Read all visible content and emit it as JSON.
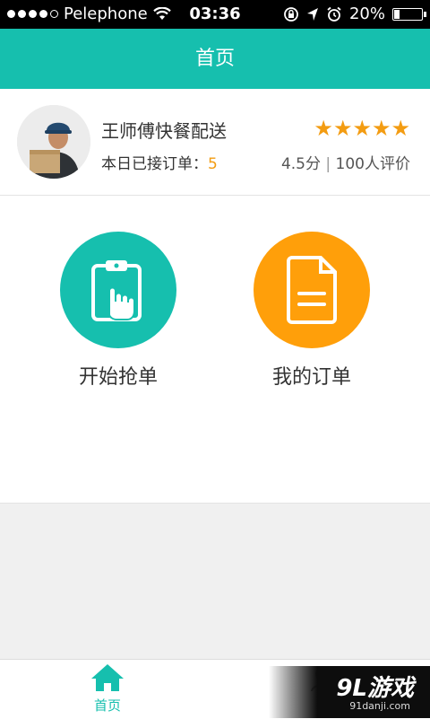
{
  "status_bar": {
    "carrier": "Pelephone",
    "time": "03:36",
    "battery": "20%"
  },
  "nav": {
    "title": "首页"
  },
  "profile": {
    "name": "王师傅快餐配送",
    "orders_label": "本日已接订单：",
    "orders_count": "5",
    "stars": "★★★★★",
    "score": "4.5分",
    "reviews": "100人评价"
  },
  "actions": {
    "grab_label": "开始抢单",
    "orders_label": "我的订单"
  },
  "tabbar": {
    "home_label": "首页"
  },
  "watermark": {
    "main": "9L游戏",
    "sub": "91danji.com"
  },
  "colors": {
    "primary": "#16bfae",
    "accent": "#f39c12",
    "orange": "#ff9f0a"
  }
}
